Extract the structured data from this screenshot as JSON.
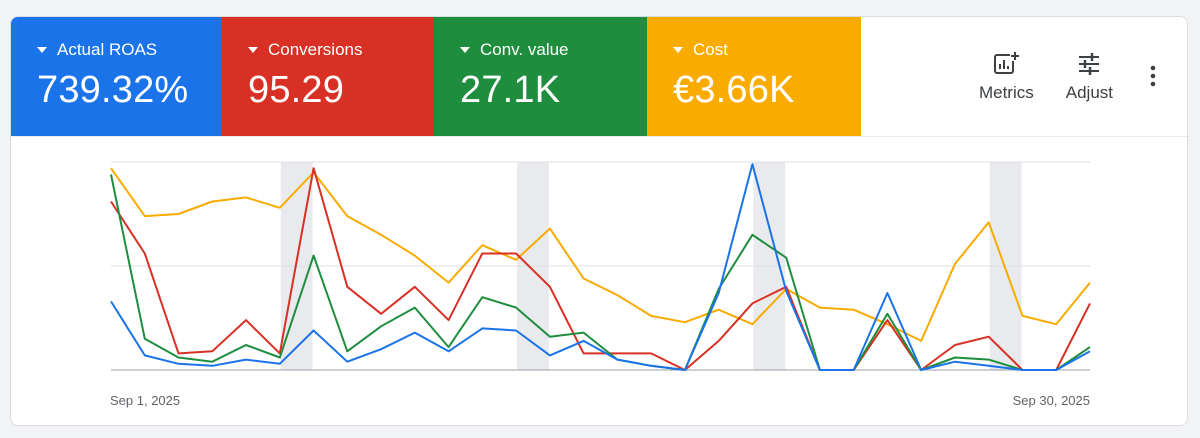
{
  "metrics": [
    {
      "label": "Actual ROAS",
      "value": "739.32%",
      "color": "#1a73e8"
    },
    {
      "label": "Conversions",
      "value": "95.29",
      "color": "#d93025"
    },
    {
      "label": "Conv. value",
      "value": "27.1K",
      "color": "#1e8e3e"
    },
    {
      "label": "Cost",
      "value": "€3.66K",
      "color": "#f9ab00"
    }
  ],
  "toolbar": {
    "metrics_label": "Metrics",
    "adjust_label": "Adjust",
    "more_icon": "more-vert-icon"
  },
  "chart_data": {
    "type": "line",
    "x_start_label": "Sep 1, 2025",
    "x_end_label": "Sep 30, 2025",
    "x": [
      "Sep 1, 2025",
      "Sep 2, 2025",
      "Sep 3, 2025",
      "Sep 4, 2025",
      "Sep 5, 2025",
      "Sep 6, 2025",
      "Sep 7, 2025",
      "Sep 8, 2025",
      "Sep 9, 2025",
      "Sep 10, 2025",
      "Sep 11, 2025",
      "Sep 12, 2025",
      "Sep 13, 2025",
      "Sep 14, 2025",
      "Sep 15, 2025",
      "Sep 16, 2025",
      "Sep 17, 2025",
      "Sep 18, 2025",
      "Sep 19, 2025",
      "Sep 20, 2025",
      "Sep 21, 2025",
      "Sep 22, 2025",
      "Sep 23, 2025",
      "Sep 24, 2025",
      "Sep 25, 2025",
      "Sep 26, 2025",
      "Sep 27, 2025",
      "Sep 28, 2025",
      "Sep 29, 2025",
      "Sep 30, 2025"
    ],
    "shaded_bands": [
      [
        "Sep 6, 2025",
        "Sep 7, 2025"
      ],
      [
        "Sep 13, 2025",
        "Sep 14, 2025"
      ],
      [
        "Sep 20, 2025",
        "Sep 21, 2025"
      ],
      [
        "Sep 27, 2025",
        "Sep 28, 2025"
      ]
    ],
    "gridlines": 3,
    "series": [
      {
        "name": "Actual ROAS",
        "color": "#1a73e8",
        "values": [
          33,
          7,
          3,
          2,
          5,
          3,
          19,
          4,
          10,
          18,
          9,
          20,
          19,
          7,
          14,
          5,
          2,
          0,
          37,
          99,
          38,
          0,
          0,
          37,
          0,
          4,
          2,
          0,
          0,
          9
        ]
      },
      {
        "name": "Conversions",
        "color": "#d93025",
        "values": [
          81,
          56,
          8,
          9,
          24,
          8,
          97,
          40,
          27,
          40,
          24,
          56,
          56,
          40,
          8,
          8,
          8,
          0,
          14,
          32,
          40,
          0,
          0,
          24,
          0,
          12,
          16,
          0,
          0,
          32
        ]
      },
      {
        "name": "Conv. value",
        "color": "#1e8e3e",
        "values": [
          94,
          15,
          6,
          4,
          12,
          6,
          55,
          9,
          21,
          30,
          11,
          35,
          30,
          16,
          18,
          5,
          2,
          0,
          39,
          65,
          54,
          0,
          0,
          27,
          0,
          6,
          5,
          0,
          0,
          11
        ]
      },
      {
        "name": "Cost",
        "color": "#f9ab00",
        "values": [
          97,
          74,
          75,
          81,
          83,
          78,
          95,
          74,
          65,
          55,
          42,
          60,
          53,
          68,
          44,
          36,
          26,
          23,
          29,
          22,
          39,
          30,
          29,
          22,
          14,
          51,
          71,
          26,
          22,
          42
        ]
      }
    ]
  }
}
